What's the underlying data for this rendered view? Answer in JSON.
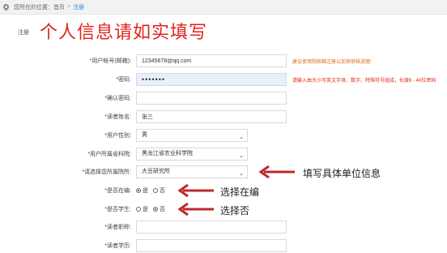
{
  "breadcrumb": {
    "prefix": "您所在的位置：",
    "home": "首页",
    "separator": ">",
    "current": "注册"
  },
  "section_label": "注册",
  "page_title": "个人信息请如实填写",
  "colors": {
    "accent_red": "#e0231b",
    "hint_orange": "#e06a1b",
    "link_blue": "#3a7bd5"
  },
  "form": {
    "account": {
      "label": "*用户帐号(邮箱):",
      "value": "12345678@qq.com",
      "hint": "建议使用院邮箱注册以加快审核进度!"
    },
    "password": {
      "label": "*密码:",
      "value": "•••••••",
      "hint": "请输入由大小写英文字母、数字、特殊符号组成，长度6 - 40位密码"
    },
    "confirm_password": {
      "label": "*确认密码:",
      "value": ""
    },
    "reader_name": {
      "label": "*读者姓名:",
      "value": "张三"
    },
    "gender": {
      "label": "*用户性别:",
      "value": "男"
    },
    "institute": {
      "label": "*用户所属省科院:",
      "value": "黑龙江省农业科学院"
    },
    "unit": {
      "label": "*请选择您所属院所:",
      "value": "大豆研究所"
    },
    "on_staff": {
      "label": "*是否在编:",
      "options": [
        "是",
        "否"
      ],
      "selected": "是"
    },
    "is_student": {
      "label": "*是否学生:",
      "options": [
        "是",
        "否"
      ],
      "selected": "否"
    },
    "title": {
      "label": "*读者职称:",
      "value": ""
    },
    "education": {
      "label": "*读者学历:",
      "value": ""
    }
  },
  "annotations": {
    "unit": "填写具体单位信息",
    "on_staff": "选择在编",
    "is_student": "选择否"
  }
}
